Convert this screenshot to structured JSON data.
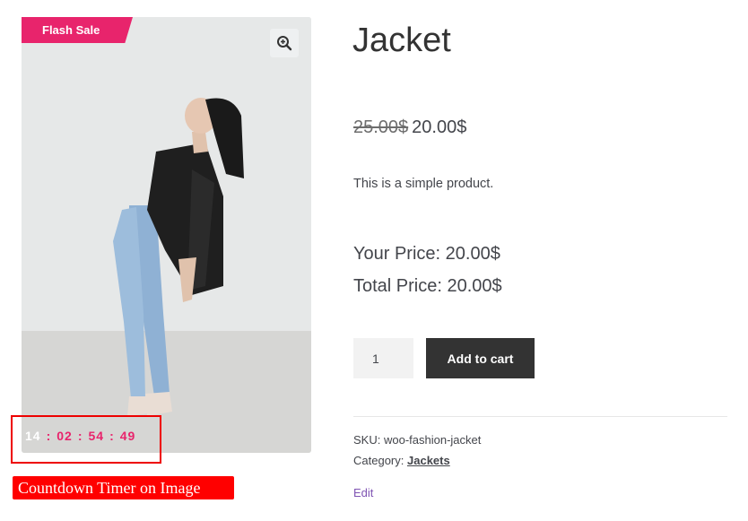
{
  "product": {
    "badge": "Flash Sale",
    "title": "Jacket",
    "old_price": "25.00$",
    "new_price": "20.00$",
    "description": "This is a simple product.",
    "your_price": "Your Price: 20.00$",
    "total_price": "Total Price: 20.00$",
    "quantity": "1",
    "add_to_cart_label": "Add to cart",
    "sku_label": "SKU:",
    "sku_value": "woo-fashion-jacket",
    "category_label": "Category:",
    "category_value": "Jackets",
    "edit_label": "Edit"
  },
  "timer": {
    "days": "14",
    "hours": "02",
    "minutes": "54",
    "seconds": "49",
    "separator": ":"
  },
  "annotation": {
    "label": "Countdown Timer on Image"
  },
  "icons": {
    "zoom": "zoom-in-icon"
  },
  "colors": {
    "accent": "#e8246c",
    "button": "#333333",
    "annotation_red": "#ff0000",
    "link_purple": "#7f54b3"
  }
}
